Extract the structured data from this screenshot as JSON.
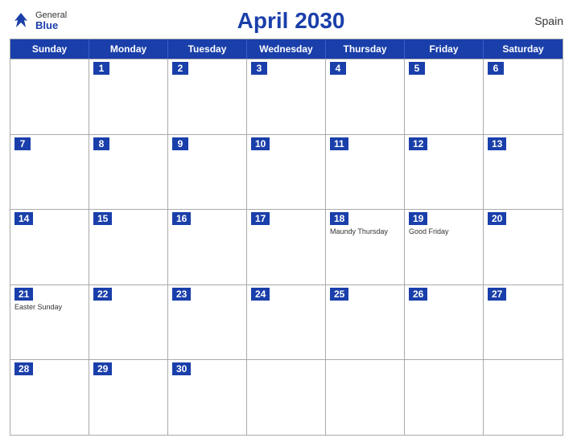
{
  "header": {
    "logo_general": "General",
    "logo_blue": "Blue",
    "title": "April 2030",
    "country": "Spain"
  },
  "weekdays": [
    "Sunday",
    "Monday",
    "Tuesday",
    "Wednesday",
    "Thursday",
    "Friday",
    "Saturday"
  ],
  "weeks": [
    [
      {
        "date": "",
        "events": []
      },
      {
        "date": "1",
        "events": []
      },
      {
        "date": "2",
        "events": []
      },
      {
        "date": "3",
        "events": []
      },
      {
        "date": "4",
        "events": []
      },
      {
        "date": "5",
        "events": []
      },
      {
        "date": "6",
        "events": []
      }
    ],
    [
      {
        "date": "7",
        "events": []
      },
      {
        "date": "8",
        "events": []
      },
      {
        "date": "9",
        "events": []
      },
      {
        "date": "10",
        "events": []
      },
      {
        "date": "11",
        "events": []
      },
      {
        "date": "12",
        "events": []
      },
      {
        "date": "13",
        "events": []
      }
    ],
    [
      {
        "date": "14",
        "events": []
      },
      {
        "date": "15",
        "events": []
      },
      {
        "date": "16",
        "events": []
      },
      {
        "date": "17",
        "events": []
      },
      {
        "date": "18",
        "events": [
          "Maundy Thursday"
        ]
      },
      {
        "date": "19",
        "events": [
          "Good Friday"
        ]
      },
      {
        "date": "20",
        "events": []
      }
    ],
    [
      {
        "date": "21",
        "events": [
          "Easter Sunday"
        ]
      },
      {
        "date": "22",
        "events": []
      },
      {
        "date": "23",
        "events": []
      },
      {
        "date": "24",
        "events": []
      },
      {
        "date": "25",
        "events": []
      },
      {
        "date": "26",
        "events": []
      },
      {
        "date": "27",
        "events": []
      }
    ],
    [
      {
        "date": "28",
        "events": []
      },
      {
        "date": "29",
        "events": []
      },
      {
        "date": "30",
        "events": []
      },
      {
        "date": "",
        "events": []
      },
      {
        "date": "",
        "events": []
      },
      {
        "date": "",
        "events": []
      },
      {
        "date": "",
        "events": []
      }
    ]
  ]
}
